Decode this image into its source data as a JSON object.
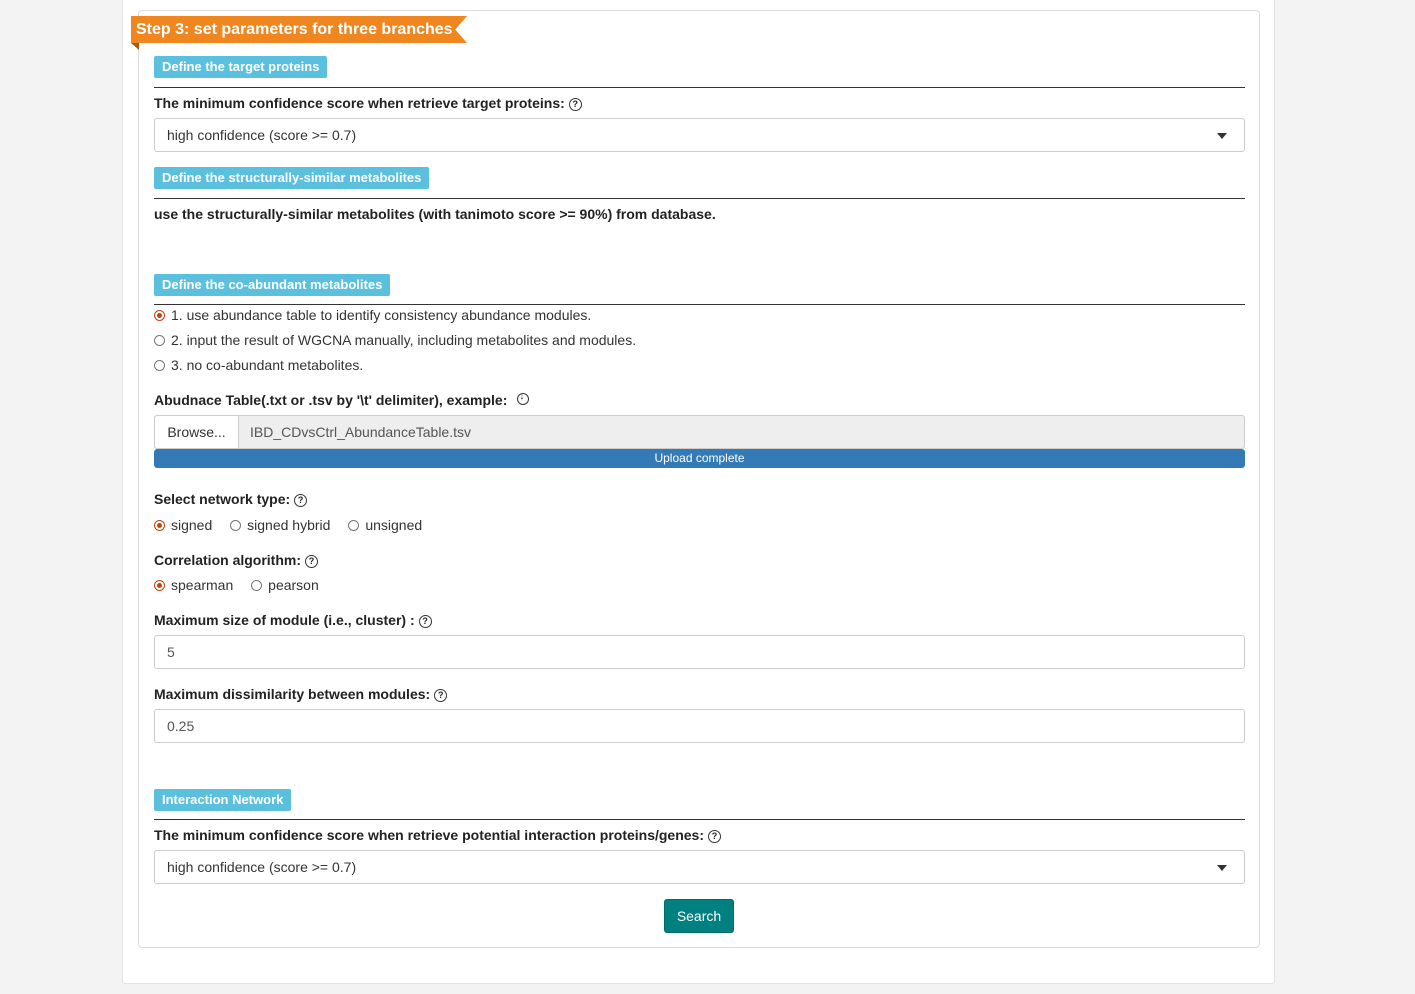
{
  "step": {
    "title": "Step 3: set parameters for three branches"
  },
  "sections": {
    "target": {
      "label": "Define the target proteins",
      "question": "The minimum confidence score when retrieve target proteins:",
      "select_value": "high confidence (score >= 0.7)"
    },
    "similar": {
      "label": "Define the structurally-similar metabolites",
      "description": "use the structurally-similar metabolites (with tanimoto score >= 90%) from database."
    },
    "coabundant": {
      "label": "Define the co-abundant metabolites",
      "options": [
        {
          "label": "1. use abundance table to identify consistency abundance modules.",
          "checked": true
        },
        {
          "label": "2. input the result of WGCNA manually, including metabolites and modules.",
          "checked": false
        },
        {
          "label": "3. no co-abundant metabolites.",
          "checked": false
        }
      ],
      "file_label": "Abudnace Table(.txt or .tsv by '\\t' delimiter), example:",
      "browse_label": "Browse...",
      "file_name": "IBD_CDvsCtrl_AbundanceTable.tsv",
      "upload_status": "Upload complete",
      "upload_progress": 1.0,
      "network_type": {
        "label": "Select network type:",
        "options": [
          {
            "label": "signed",
            "checked": true
          },
          {
            "label": "signed hybrid",
            "checked": false
          },
          {
            "label": "unsigned",
            "checked": false
          }
        ]
      },
      "correlation": {
        "label": "Correlation algorithm:",
        "options": [
          {
            "label": "spearman",
            "checked": true
          },
          {
            "label": "pearson",
            "checked": false
          }
        ]
      },
      "max_module": {
        "label": "Maximum size of module (i.e., cluster) :",
        "value": "5"
      },
      "max_dissimilarity": {
        "label": "Maximum dissimilarity between modules:",
        "value": "0.25"
      }
    },
    "interaction": {
      "label": "Interaction Network",
      "question": "The minimum confidence score when retrieve potential interaction proteins/genes:",
      "select_value": "high confidence (score >= 0.7)"
    }
  },
  "search": {
    "label": "Search"
  },
  "colors": {
    "ribbon": "#f0861f",
    "section_label": "#5bc0de",
    "progress": "#337ab7",
    "search_button": "#008080",
    "radio_checked": "#c1440e"
  },
  "icons": {
    "help": "question-circle-icon",
    "download": "download-circle-icon",
    "dropdown": "caret-down-icon"
  }
}
